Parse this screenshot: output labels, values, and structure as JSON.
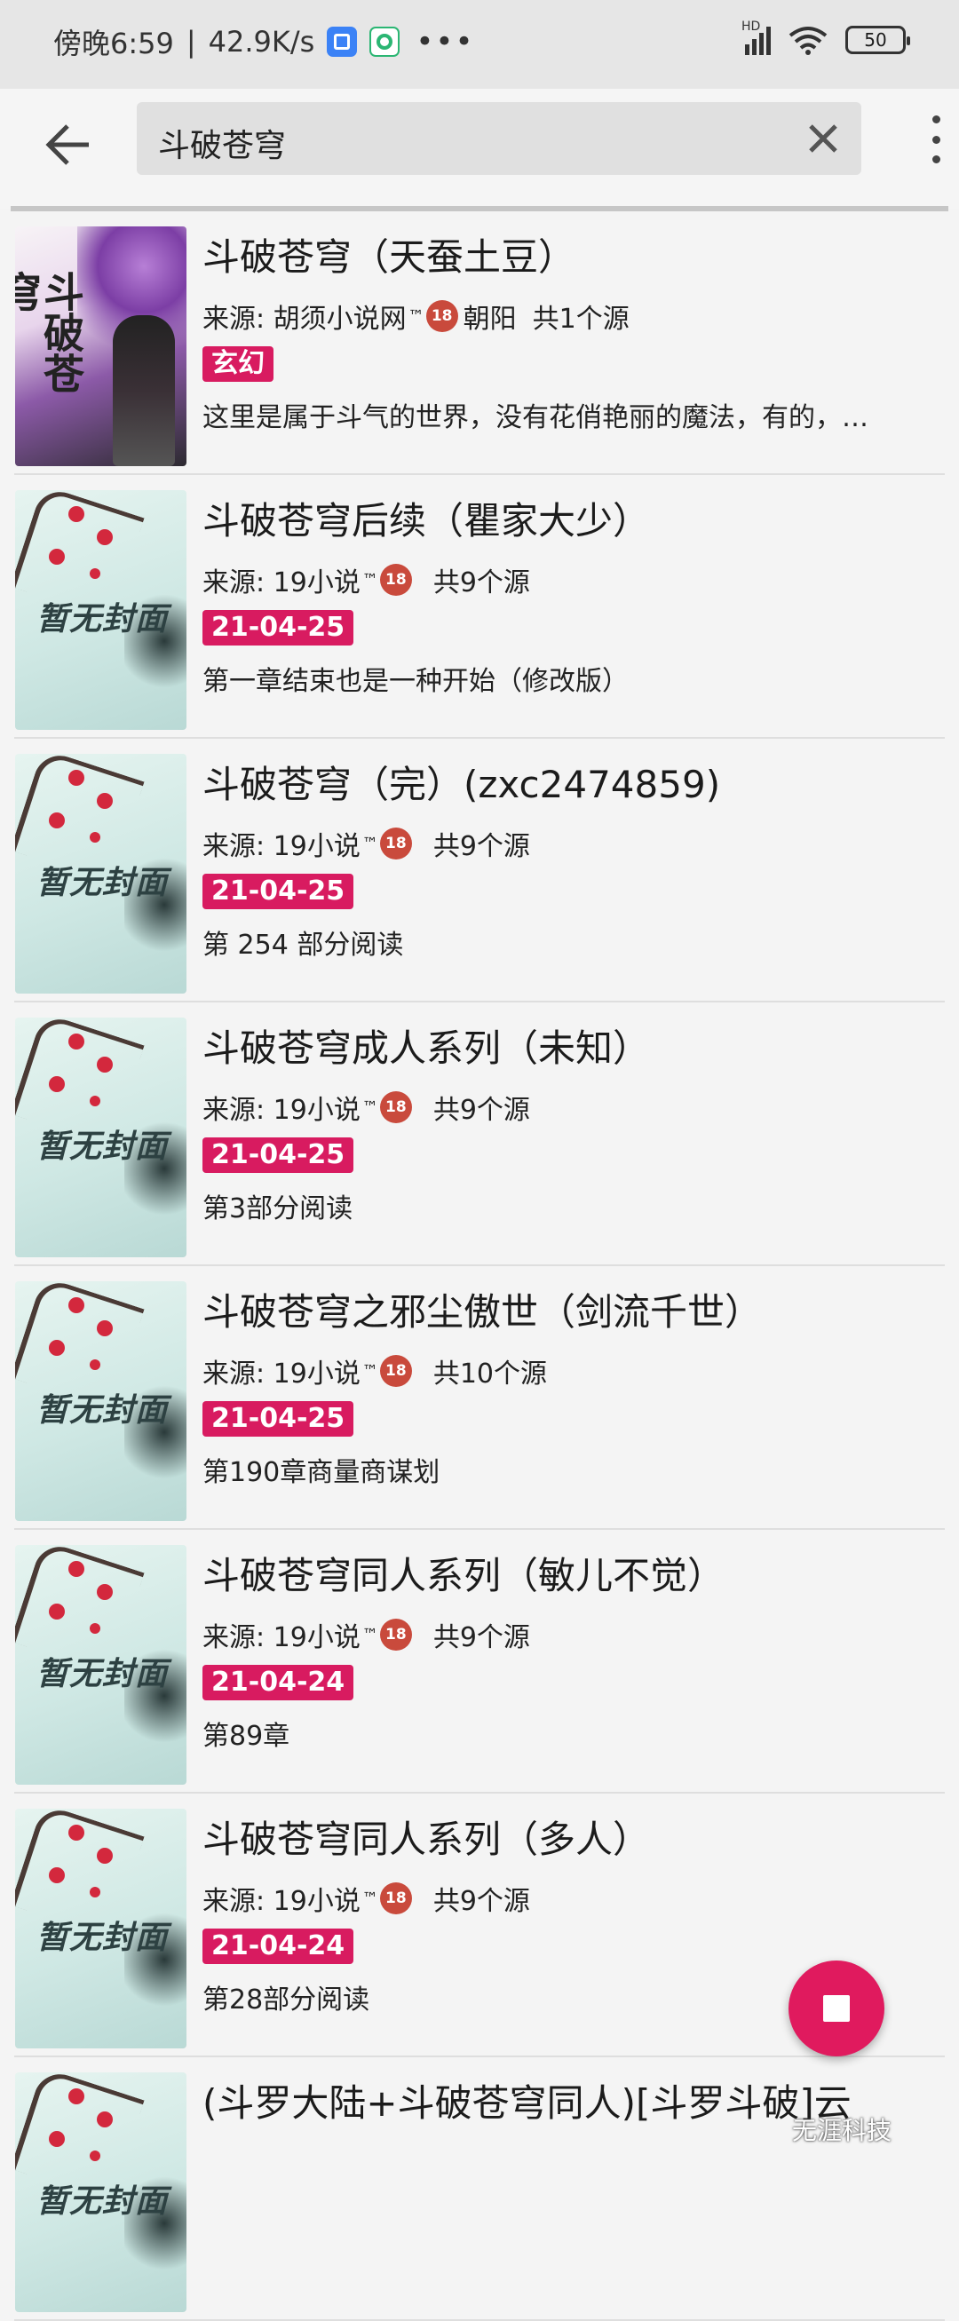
{
  "status_bar": {
    "time": "傍晚6:59",
    "speed": "42.9K/s",
    "separator": "|",
    "more": "•••",
    "battery": "50"
  },
  "toolbar": {
    "back_icon": "arrow-left-icon",
    "search_value": "斗破苍穹",
    "clear_icon": "close-icon",
    "more_icon": "more-vert-icon"
  },
  "results": [
    {
      "title": "斗破苍穹（天蚕土豆）",
      "source": "来源: 胡须小说网",
      "source_extra": "朝阳",
      "count": "共1个源",
      "tag": "玄幻",
      "latest": "这里是属于斗气的世界，没有花俏艳丽的魔法，有的，…",
      "cover": "real",
      "cover_text": "斗破苍穹"
    },
    {
      "title": "斗破苍穹后续（瞿家大少）",
      "source": "来源: 19小说",
      "source_extra": "",
      "count": "共9个源",
      "tag": "21-04-25",
      "latest": "第一章结束也是一种开始（修改版）",
      "cover": "placeholder",
      "cover_text": "暂无封面"
    },
    {
      "title": "斗破苍穹（完）(zxc2474859)",
      "source": "来源: 19小说",
      "source_extra": "",
      "count": "共9个源",
      "tag": "21-04-25",
      "latest": "第 254 部分阅读",
      "cover": "placeholder",
      "cover_text": "暂无封面"
    },
    {
      "title": "斗破苍穹成人系列（未知）",
      "source": "来源: 19小说",
      "source_extra": "",
      "count": "共9个源",
      "tag": "21-04-25",
      "latest": "第3部分阅读",
      "cover": "placeholder",
      "cover_text": "暂无封面"
    },
    {
      "title": "斗破苍穹之邪尘傲世（剑流千世）",
      "source": "来源: 19小说",
      "source_extra": "",
      "count": "共10个源",
      "tag": "21-04-25",
      "latest": "第190章商量商谋划",
      "cover": "placeholder",
      "cover_text": "暂无封面"
    },
    {
      "title": "斗破苍穹同人系列（敏儿不觉）",
      "source": "来源: 19小说",
      "source_extra": "",
      "count": "共9个源",
      "tag": "21-04-24",
      "latest": "第89章",
      "cover": "placeholder",
      "cover_text": "暂无封面"
    },
    {
      "title": "斗破苍穹同人系列（多人）",
      "source": "来源: 19小说",
      "source_extra": "",
      "count": "共9个源",
      "tag": "21-04-24",
      "latest": "第28部分阅读",
      "cover": "placeholder",
      "cover_text": "暂无封面"
    },
    {
      "title": "(斗罗大陆+斗破苍穹同人)[斗罗斗破]云",
      "source": "",
      "source_extra": "",
      "count": "",
      "tag": "",
      "latest": "",
      "cover": "placeholder",
      "cover_text": "暂无封面"
    }
  ],
  "common": {
    "tm": "™",
    "r18": "18"
  },
  "fab": {
    "icon": "stop-icon"
  },
  "watermark": "无涯科技"
}
